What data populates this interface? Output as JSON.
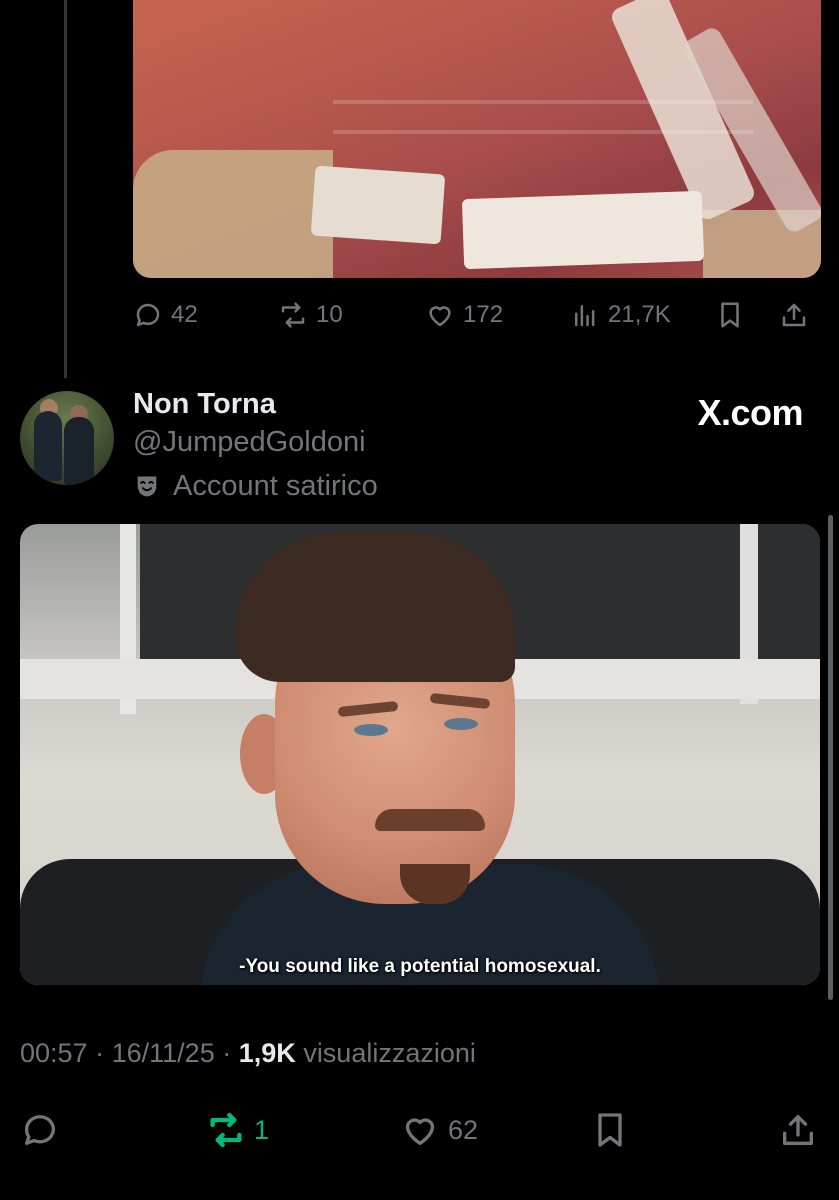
{
  "quoted_tweet_actions": {
    "replies": "42",
    "reposts": "10",
    "likes": "172",
    "views": "21,7K"
  },
  "author": {
    "name": "Non Torna",
    "handle": "@JumpedGoldoni",
    "badge_label": "Account satirico",
    "badge_icon": "theater-mask-icon"
  },
  "watermark": "X.com",
  "media": {
    "subtitle": "-You sound like a potential homosexual."
  },
  "tweet_meta": {
    "time": "00:57",
    "separator": "·",
    "date": "16/11/25",
    "views_count": "1,9K",
    "views_label": "visualizzazioni"
  },
  "tweet_actions": {
    "reposts": "1",
    "likes": "62"
  },
  "colors": {
    "background": "#000000",
    "muted_text": "#71767b",
    "primary_text": "#e7e9ea",
    "repost_active": "#00ba7c"
  }
}
